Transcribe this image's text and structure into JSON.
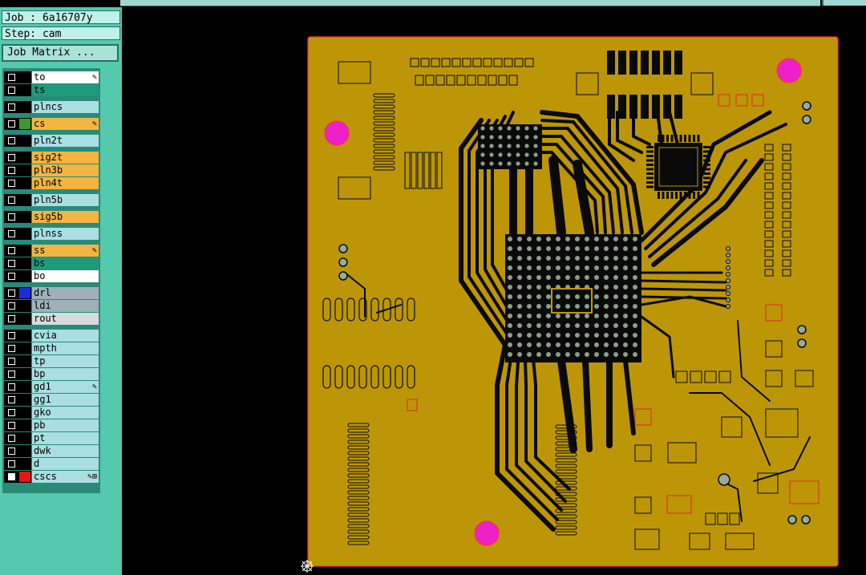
{
  "job": {
    "label": "Job : 6a16707y"
  },
  "step": {
    "label": "Step: cam"
  },
  "job_matrix_button": "Job Matrix ...",
  "layers": [
    {
      "name": "to",
      "color": "#ffffff",
      "sw": "#000000",
      "checked": false,
      "flag": "✎"
    },
    {
      "name": "ts",
      "color": "#1f9a7c",
      "sw": "#000000",
      "checked": false,
      "flag": ""
    },
    {
      "name": "plncs",
      "color": "#a9dfe3",
      "sw": "#000000",
      "checked": false,
      "flag": ""
    },
    {
      "name": "cs",
      "color": "#f3b541",
      "sw": "#3c9a2e",
      "checked": false,
      "flag": "✎"
    },
    {
      "name": "pln2t",
      "color": "#a9dfe3",
      "sw": "#000000",
      "checked": false,
      "flag": ""
    },
    {
      "name": "sig2t",
      "color": "#f3b541",
      "sw": "#000000",
      "checked": false,
      "flag": ""
    },
    {
      "name": "pln3b",
      "color": "#f3b541",
      "sw": "#000000",
      "checked": false,
      "flag": ""
    },
    {
      "name": "pln4t",
      "color": "#f3b541",
      "sw": "#000000",
      "checked": false,
      "flag": ""
    },
    {
      "name": "pln5b",
      "color": "#a9dfe3",
      "sw": "#000000",
      "checked": false,
      "flag": ""
    },
    {
      "name": "sig5b",
      "color": "#f3b541",
      "sw": "#000000",
      "checked": false,
      "flag": ""
    },
    {
      "name": "plnss",
      "color": "#a9dfe3",
      "sw": "#000000",
      "checked": false,
      "flag": ""
    },
    {
      "name": "ss",
      "color": "#f3b541",
      "sw": "#000000",
      "checked": false,
      "flag": "✎"
    },
    {
      "name": "bs",
      "color": "#1f9a7c",
      "sw": "#000000",
      "checked": false,
      "flag": ""
    },
    {
      "name": "bo",
      "color": "#ffffff",
      "sw": "#000000",
      "checked": false,
      "flag": ""
    },
    {
      "name": "drl",
      "color": "#9fb0b8",
      "sw": "#1a2ee0",
      "checked": false,
      "flag": ""
    },
    {
      "name": "ldi",
      "color": "#9fb0b8",
      "sw": "#000000",
      "checked": false,
      "flag": ""
    },
    {
      "name": "rout",
      "color": "#d6dcde",
      "sw": "#000000",
      "checked": false,
      "flag": ""
    },
    {
      "name": "cvia",
      "color": "#a9dfe3",
      "sw": "#000000",
      "checked": false,
      "flag": ""
    },
    {
      "name": "mpth",
      "color": "#a9dfe3",
      "sw": "#000000",
      "checked": false,
      "flag": ""
    },
    {
      "name": "tp",
      "color": "#a9dfe3",
      "sw": "#000000",
      "checked": false,
      "flag": ""
    },
    {
      "name": "bp",
      "color": "#a9dfe3",
      "sw": "#000000",
      "checked": false,
      "flag": ""
    },
    {
      "name": "gd1",
      "color": "#a9dfe3",
      "sw": "#000000",
      "checked": false,
      "flag": "✎"
    },
    {
      "name": "gg1",
      "color": "#a9dfe3",
      "sw": "#000000",
      "checked": false,
      "flag": ""
    },
    {
      "name": "gko",
      "color": "#a9dfe3",
      "sw": "#000000",
      "checked": false,
      "flag": ""
    },
    {
      "name": "pb",
      "color": "#a9dfe3",
      "sw": "#000000",
      "checked": false,
      "flag": ""
    },
    {
      "name": "pt",
      "color": "#a9dfe3",
      "sw": "#000000",
      "checked": false,
      "flag": ""
    },
    {
      "name": "dwk",
      "color": "#a9dfe3",
      "sw": "#000000",
      "checked": false,
      "flag": ""
    },
    {
      "name": "d",
      "color": "#a9dfe3",
      "sw": "#000000",
      "checked": false,
      "flag": ""
    },
    {
      "name": "cscs",
      "color": "#a9dfe3",
      "sw": "#ee1111",
      "checked": true,
      "flag": "✎⊞"
    }
  ],
  "colors": {
    "board": "#bc9606",
    "trace": "#0a0a0a",
    "via_pad": "#8aa088",
    "fiducial": "#ee20c8",
    "outline": "#ff2a2a"
  }
}
